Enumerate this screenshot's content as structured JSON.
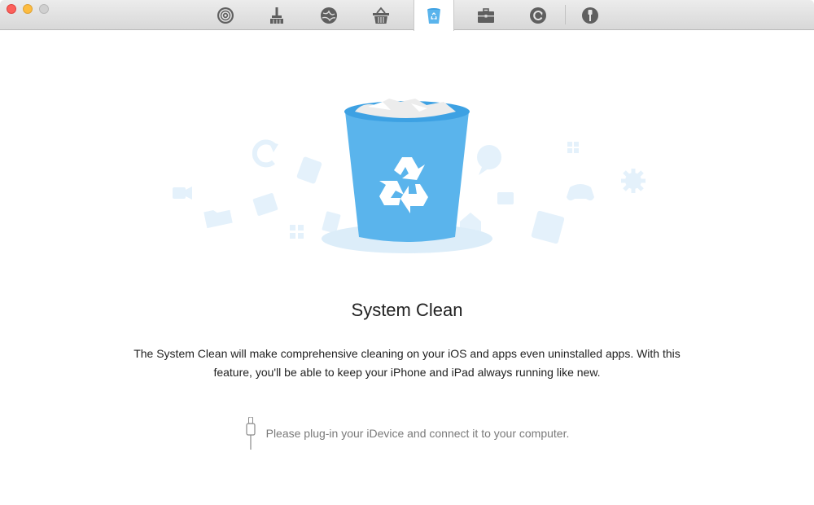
{
  "window": {
    "controls": [
      "close",
      "minimize",
      "zoom"
    ]
  },
  "toolbar": {
    "tabs": [
      {
        "icon": "airdrop-icon",
        "active": false
      },
      {
        "icon": "broom-icon",
        "active": false
      },
      {
        "icon": "globe-icon",
        "active": false
      },
      {
        "icon": "basket-icon",
        "active": false
      },
      {
        "icon": "trash-icon",
        "active": true
      },
      {
        "icon": "toolbox-icon",
        "active": false
      },
      {
        "icon": "restore-icon",
        "active": false
      },
      {
        "icon": "usb-icon",
        "active": false
      }
    ],
    "accent_color": "#5ab4ec"
  },
  "hero": {
    "icon": "trash-bin-illustration"
  },
  "main": {
    "title": "System Clean",
    "description": "The System Clean will make comprehensive cleaning on your iOS and apps even uninstalled apps. With this feature, you'll be able to keep your iPhone and iPad always running like new.",
    "plug_hint": "Please plug-in your iDevice and connect it to your computer."
  }
}
